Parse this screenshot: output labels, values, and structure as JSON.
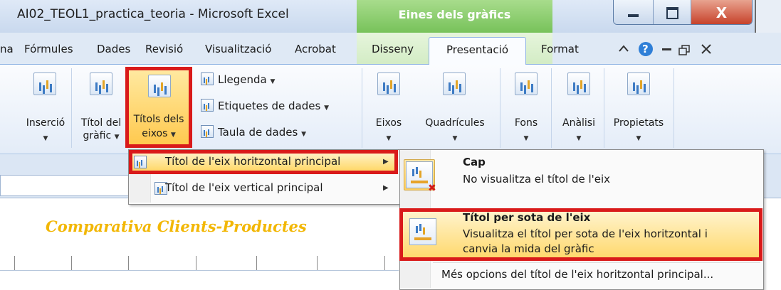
{
  "window": {
    "title": "AI02_TEOL1_practica_teoria - Microsoft Excel",
    "tools_header": "Eines dels gràfics",
    "close_label": "X"
  },
  "tabs": {
    "partial": "na",
    "formules": "Fórmules",
    "dades": "Dades",
    "revisio": "Revisió",
    "visualitzacio": "Visualització",
    "acrobat": "Acrobat",
    "disseny": "Disseny",
    "presentacio": "Presentació",
    "format": "Format"
  },
  "ribbon": {
    "insercio": "Inserció",
    "titol_grafic": [
      "Títol del",
      "gràfic"
    ],
    "titols_eixos": [
      "Títols dels",
      "eixos"
    ],
    "llegenda": "Llegenda",
    "etiquetes": "Etiquetes de dades",
    "taula": "Taula de dades",
    "eixos": "Eixos",
    "quadricules": "Quadrícules",
    "fons": "Fons",
    "analisi": "Anàlisi",
    "propietats": "Propietats"
  },
  "menu1": {
    "item1": "Títol de l'eix horitzontal principal",
    "item2": "Títol de l'eix vertical principal"
  },
  "menu2": {
    "cap_title": "Cap",
    "cap_desc": "No visualitza el títol de l'eix",
    "below_title": "Títol per sota de l'eix",
    "below_desc1": "Visualitza el títol per sota de l'eix horitzontal i",
    "below_desc2": "canvia la mida del gràfic",
    "more_options": "Més opcions del títol de l'eix horitzontal principal..."
  },
  "sheet": {
    "chart_title": "Comparativa Clients-Productes"
  },
  "colors": {
    "highlight_border": "#d91a1a",
    "chart_title": "#f2b705",
    "tools_green": "#77c25a"
  }
}
